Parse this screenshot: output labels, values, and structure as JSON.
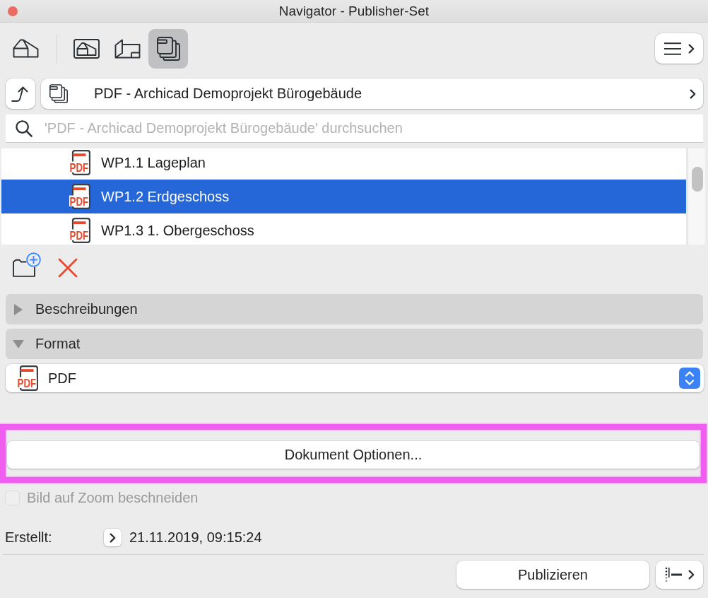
{
  "window": {
    "title": "Navigator - Publisher-Set"
  },
  "toolbar": {
    "views": [
      {
        "kind": "house",
        "selected": false
      },
      {
        "kind": "framed",
        "selected": false
      },
      {
        "kind": "sheet",
        "selected": false
      },
      {
        "kind": "stack",
        "selected": true
      }
    ]
  },
  "path": {
    "label": "PDF - Archicad Demoprojekt Bürogebäude"
  },
  "search": {
    "placeholder": "'PDF - Archicad Demoprojekt Bürogebäude' durchsuchen"
  },
  "items": [
    {
      "label": "WP1.1 Lageplan",
      "icon_text": "PDF",
      "selected": false
    },
    {
      "label": "WP1.2 Erdgeschoss",
      "icon_text": "PDF",
      "selected": true
    },
    {
      "label": "WP1.3 1. Obergeschoss",
      "icon_text": "PDF",
      "selected": false
    }
  ],
  "sections": [
    {
      "label": "Beschreibungen",
      "expanded": false
    },
    {
      "label": "Format",
      "expanded": true
    }
  ],
  "format": {
    "value": "PDF",
    "icon_text": "PDF"
  },
  "document_options": {
    "label": "Dokument Optionen...",
    "highlighted": true
  },
  "crop_option": {
    "label": "Bild auf Zoom beschneiden",
    "checked": false,
    "disabled": true
  },
  "created": {
    "label": "Erstellt:",
    "value": "21.11.2019, 09:15:24"
  },
  "publish": {
    "label": "Publizieren"
  }
}
